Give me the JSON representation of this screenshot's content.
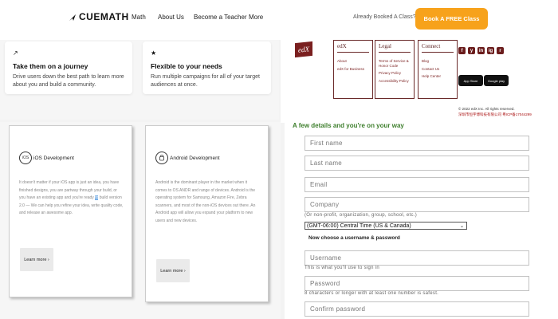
{
  "cuemath": {
    "brand": "CUEMATH",
    "nav": [
      "Math",
      "About Us",
      "Become a Teacher",
      "More"
    ],
    "booked": "Already Booked A Class?",
    "cta": "Book A FREE Class",
    "cards": [
      {
        "icon": "trend-icon",
        "title": "Take them on a journey",
        "desc": "Drive users down the best path to learn more about you and build a community."
      },
      {
        "icon": "star-icon",
        "title": "Flexible to your needs",
        "desc": "Run multiple campaigns for all of your target audiences at once."
      }
    ]
  },
  "edx": {
    "logo": "edX",
    "columns": [
      {
        "title": "edX",
        "links": [
          "About",
          "edX for Business"
        ]
      },
      {
        "title": "Legal",
        "links": [
          "Terms of Service & Honor Code",
          "Privacy Policy",
          "Accessibility Policy"
        ]
      },
      {
        "title": "Connect",
        "links": [
          "Blog",
          "Contact Us",
          "Help Center"
        ]
      }
    ],
    "social": [
      "f",
      "y",
      "in",
      "ig",
      "r"
    ],
    "stores": [
      "App Store",
      "Google play"
    ],
    "copyright": "© 2022 edX Inc. All rights reserved.",
    "icp": "深圳市恒宇博科技有限公司 粤ICP备17044299"
  },
  "dev": {
    "ios": {
      "icon_text": "iOS",
      "title": "iOS Development",
      "desc_before": "It doesn't matter if your iOS app is just an idea, you have finished designs, you are partway through your build, or you have an existing app and you're ready ",
      "desc_hl": "to",
      "desc_after": " build version 2.0 — We can help you refine your idea, write quality code, and release an awesome app.",
      "button": "Learn more ›"
    },
    "android": {
      "title": "Android Development",
      "desc": "Android is the dominant player in the market when it comes to OS ANDR and range of devices. Android is the operating system for Samsung, Amazon Fire, Zebra scanners, and most of the non-iOS devices out there. An Android app will allow you expand your platform to new users and new devices.",
      "button": "Learn more ›"
    }
  },
  "form": {
    "heading": "A few details and you're on your way",
    "first_name": "First name",
    "last_name": "Last name",
    "email": "Email",
    "company": "Company",
    "company_hint": "(Or non-profit, organization, group, school, etc.)",
    "timezone": "(GMT-06:00) Central Time (US & Canada)",
    "sub_heading": "Now choose a username & password",
    "username": "Username",
    "username_hint": "This is what you'll use to sign in",
    "password": "Password",
    "password_hint": "8 characters or longer with at least one number is safest.",
    "confirm": "Confirm password"
  },
  "colors": {
    "cta": "#f7a21b",
    "edx_maroon": "#6b1d1d",
    "form_green": "#3e7f2d"
  }
}
